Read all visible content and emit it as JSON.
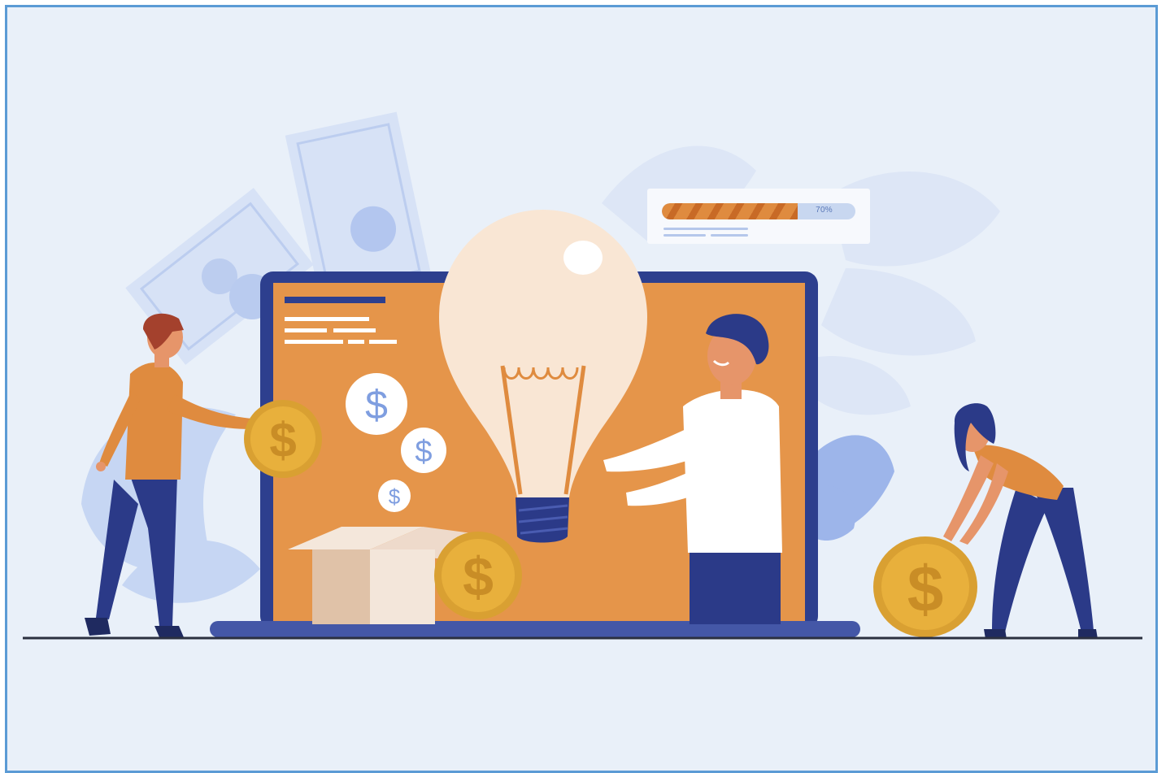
{
  "illustration": {
    "progress_widget": {
      "label": "70%",
      "value": 0.7
    },
    "coin_symbol": "$",
    "colors": {
      "background": "#e9f0f9",
      "frame_border": "#5b9bd5",
      "laptop_screen": "#e5954a",
      "laptop_frame": "#2d3f8e",
      "coin_gold": "#e8b03c",
      "bulb_glass": "#f9e6d4",
      "pants_navy": "#2b3a88",
      "shirt_orange": "#df8b3f"
    }
  }
}
